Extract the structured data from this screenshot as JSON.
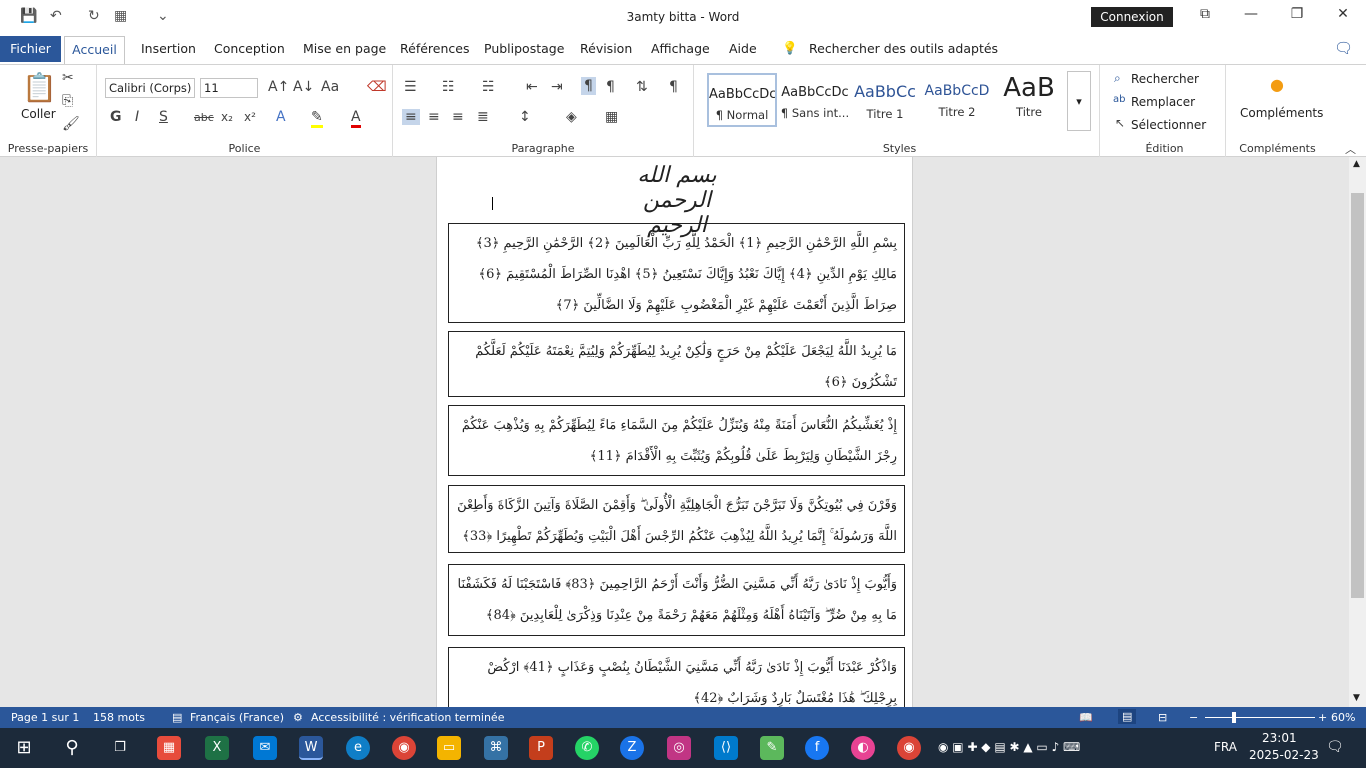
{
  "window": {
    "title": "3amty bitta - Word",
    "signin": "Connexion"
  },
  "tabs": [
    "Fichier",
    "Accueil",
    "Insertion",
    "Conception",
    "Mise en page",
    "Références",
    "Publipostage",
    "Révision",
    "Affichage",
    "Aide"
  ],
  "search_placeholder": "Rechercher des outils adaptés",
  "ribbon": {
    "clipboard": {
      "paste": "Coller",
      "label": "Presse-papiers"
    },
    "font": {
      "name": "Calibri (Corps)",
      "size": "11",
      "label": "Police",
      "bold": "G",
      "italic": "I",
      "underline": "S",
      "strike": "abc",
      "sub": "x₂",
      "sup": "x²",
      "case": "Aa"
    },
    "paragraph": {
      "label": "Paragraphe"
    },
    "styles": {
      "label": "Styles",
      "items": [
        {
          "preview": "AaBbCcDc",
          "name": "¶ Normal",
          "color": "#000000"
        },
        {
          "preview": "AaBbCcDc",
          "name": "¶ Sans int...",
          "color": "#000000"
        },
        {
          "preview": "AaBbCc",
          "name": "Titre 1",
          "color": "#2f5496"
        },
        {
          "preview": "AaBbCcD",
          "name": "Titre 2",
          "color": "#2f5496"
        },
        {
          "preview": "AaB",
          "name": "Titre",
          "color": "#000000"
        }
      ]
    },
    "editing": {
      "label": "Édition",
      "find": "Rechercher",
      "replace": "Remplacer",
      "select": "Sélectionner"
    },
    "addins": {
      "button": "Compléments",
      "label": "Compléments"
    }
  },
  "document": {
    "basmala": "بسم الله الرحمن الرحيم",
    "verses": [
      "بِسْمِ اللَّهِ الرَّحْمَٰنِ الرَّحِيمِ ﴿1﴾ الْحَمْدُ لِلَّهِ رَبِّ الْعَالَمِينَ ﴿2﴾ الرَّحْمَٰنِ الرَّحِيمِ ﴿3﴾ مَالِكِ يَوْمِ الدِّينِ ﴿4﴾ إِيَّاكَ نَعْبُدُ وَإِيَّاكَ نَسْتَعِينُ ﴿5﴾ اهْدِنَا الصِّرَاطَ الْمُسْتَقِيمَ ﴿6﴾ صِرَاطَ الَّذِينَ أَنْعَمْتَ عَلَيْهِمْ غَيْرِ الْمَغْضُوبِ عَلَيْهِمْ وَلَا الضَّالِّينَ ﴿7﴾",
      "مَا يُرِيدُ اللَّهُ لِيَجْعَلَ عَلَيْكُمْ مِنْ حَرَجٍ وَلَٰكِنْ يُرِيدُ لِيُطَهِّرَكُمْ وَلِيُتِمَّ نِعْمَتَهُ عَلَيْكُمْ لَعَلَّكُمْ تَشْكُرُونَ ﴿6﴾",
      "إِذْ يُغَشِّيكُمُ النُّعَاسَ أَمَنَةً مِنْهُ وَيُنَزِّلُ عَلَيْكُمْ مِنَ السَّمَاءِ مَاءً لِيُطَهِّرَكُمْ بِهِ وَيُذْهِبَ عَنْكُمْ رِجْزَ الشَّيْطَانِ وَلِيَرْبِطَ عَلَىٰ قُلُوبِكُمْ وَيُثَبِّتَ بِهِ الْأَقْدَامَ ﴿11﴾",
      "وَقَرْنَ فِي بُيُوتِكُنَّ وَلَا تَبَرَّجْنَ تَبَرُّجَ الْجَاهِلِيَّةِ الْأُولَىٰ ۖ وَأَقِمْنَ الصَّلَاةَ وَآتِينَ الزَّكَاةَ وَأَطِعْنَ اللَّهَ وَرَسُولَهُ ۚ إِنَّمَا يُرِيدُ اللَّهُ لِيُذْهِبَ عَنْكُمُ الرِّجْسَ أَهْلَ الْبَيْتِ وَيُطَهِّرَكُمْ تَطْهِيرًا ﴿33﴾",
      "وَأَيُّوبَ إِذْ نَادَىٰ رَبَّهُ أَنِّي مَسَّنِيَ الضُّرُّ وَأَنْتَ أَرْحَمُ الرَّاحِمِينَ ﴿83﴾ فَاسْتَجَبْنَا لَهُ فَكَشَفْنَا مَا بِهِ مِنْ ضُرٍّ ۖ وَآتَيْنَاهُ أَهْلَهُ وَمِثْلَهُمْ مَعَهُمْ رَحْمَةً مِنْ عِنْدِنَا وَذِكْرَىٰ لِلْعَابِدِينَ ﴿84﴾",
      "وَاذْكُرْ عَبْدَنَا أَيُّوبَ إِذْ نَادَىٰ رَبَّهُ أَنِّي مَسَّنِيَ الشَّيْطَانُ بِنُصْبٍ وَعَذَابٍ ﴿41﴾ ارْكُضْ بِرِجْلِكَ ۖ هَٰذَا مُغْتَسَلٌ بَارِدٌ وَشَرَابٌ ﴿42﴾"
    ]
  },
  "status": {
    "page": "Page 1 sur 1",
    "words": "158 mots",
    "language": "Français (France)",
    "accessibility": "Accessibilité : vérification terminée",
    "zoom": "60%"
  },
  "taskbar": {
    "time": "23:01",
    "date": "2025-02-23",
    "lang": "FRA"
  }
}
